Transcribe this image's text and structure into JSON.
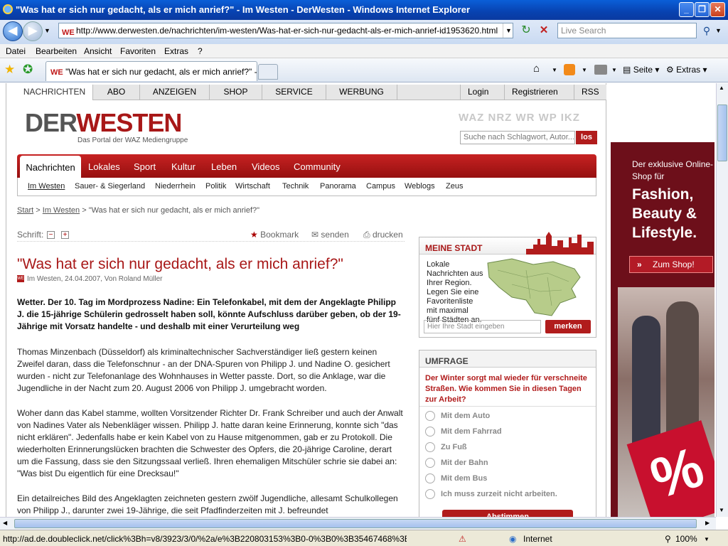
{
  "window": {
    "title": "\"Was hat er sich nur gedacht, als er mich anrief?\" - Im Westen - DerWesten - Windows Internet Explorer",
    "minimize": "_",
    "maximize": "❐",
    "close": "✕"
  },
  "address": {
    "favicon": "WE",
    "url": "http://www.derwesten.de/nachrichten/im-westen/Was-hat-er-sich-nur-gedacht-als-er-mich-anrief-id1953620.html",
    "search_placeholder": "Live Search"
  },
  "menu": [
    "Datei",
    "Bearbeiten",
    "Ansicht",
    "Favoriten",
    "Extras",
    "?"
  ],
  "tabs": {
    "active_label": "\"Was hat er sich nur gedacht, als er mich anrief?\" - Im...",
    "tools": {
      "page": "Seite",
      "extras": "Extras"
    }
  },
  "site": {
    "topnav": [
      "NACHRICHTEN",
      "ABO",
      "ANZEIGEN",
      "SHOP",
      "SERVICE",
      "WERBUNG"
    ],
    "topnav_right": [
      "Login",
      "Registrieren",
      "RSS"
    ],
    "logo_der": "DER",
    "logo_westen": "WESTEN",
    "slogan": "Das Portal der WAZ Mediengruppe",
    "brands": "WAZ NRZ WR WP IKZ",
    "search_placeholder": "Suche nach Schlagwort, Autor...",
    "search_button": "los",
    "mainnav": [
      "Nachrichten",
      "Lokales",
      "Sport",
      "Kultur",
      "Leben",
      "Videos",
      "Community"
    ],
    "subnav": [
      "Im Westen",
      "Sauer- & Siegerland",
      "Niederrhein",
      "Politik",
      "Wirtschaft",
      "Technik",
      "Panorama",
      "Campus",
      "Weblogs",
      "Zeus"
    ]
  },
  "breadcrumb": {
    "start": "Start",
    "section": "Im Westen",
    "current": "> \"Was hat er sich nur gedacht, als er mich anrief?\""
  },
  "article_tools": {
    "schrift": "Schrift:",
    "minus": "−",
    "plus": "+",
    "bookmark": "Bookmark",
    "send": "senden",
    "print": "drucken"
  },
  "article": {
    "headline": "\"Was hat er sich nur gedacht, als er mich anrief?\"",
    "meta": "Im Westen, 24.04.2007, Von Roland Müller",
    "lead": "Wetter. Der 10. Tag im Mordprozess Nadine: Ein Telefonkabel, mit dem der Angeklagte Philipp J. die 15-jährige Schülerin gedrosselt haben soll, könnte Aufschluss darüber geben, ob der 19-Jährige mit Vorsatz handelte - und deshalb mit einer Verurteilung weg",
    "p1": "Thomas Minzenbach (Düsseldorf) als kriminaltechnischer Sachverständiger ließ gestern keinen Zweifel daran, dass die Telefonschnur - an der DNA-Spuren von Philipp J. und Nadine O. gesichert wurden - nicht zur Telefonanlage des Wohnhauses in Wetter passte. Dort, so die Anklage, war die Jugendliche in der Nacht zum 20. August 2006 von Philipp J. umgebracht worden.",
    "p2": "Woher dann das Kabel stamme, wollten Vorsitzender Richter Dr. Frank Schreiber und auch der Anwalt von Nadines Vater als Nebenkläger wissen. Philipp J. hatte daran keine Erinnerung, konnte sich \"das nicht erklären\". Jedenfalls habe er kein Kabel von zu Hause mitgenommen, gab er zu Protokoll. Die wiederholten Erinnerungslücken brachten die Schwester des Opfers, die 20-jährige Caroline, derart um die Fassung, dass sie den Sitzungssaal verließ. Ihren ehemaligen Mitschüler schrie sie dabei an: \"Was bist Du eigentlich für eine Drecksau!\"",
    "p3": "Ein detailreiches Bild des Angeklagten zeichneten gestern zwölf Jugendliche, allesamt Schulkollegen von Philipp J., darunter zwei 19-Jährige, die seit Pfadfinderzeiten mit J. befreundet"
  },
  "meine_stadt": {
    "title": "MEINE STADT",
    "text": "Lokale Nachrichten aus Ihrer Region. Legen Sie eine Favoritenliste mit maximal fünf Städten an.",
    "input_placeholder": "Hier Ihre Stadt eingeben",
    "button": "merken"
  },
  "umfrage": {
    "title": "UMFRAGE",
    "question": "Der Winter sorgt mal wieder für verschneite Straßen. Wie kommen Sie in diesen Tagen zur Arbeit?",
    "options": [
      "Mit dem Auto",
      "Mit dem Fahrrad",
      "Zu Fuß",
      "Mit der Bahn",
      "Mit dem Bus",
      "Ich muss zurzeit nicht arbeiten."
    ],
    "button": "Abstimmen"
  },
  "ad": {
    "line1": "Der exklusive Online-Shop für",
    "line2": "Fashion, Beauty & Lifestyle.",
    "button": "Zum Shop!",
    "badge": "%"
  },
  "status": {
    "text": "http://ad.de.doubleclick.net/click%3Bh=v8/3923/3/0/%2a/e%3B220803153%3B0-0%3B0%3B35467468%3B933-12(",
    "zone": "Internet",
    "zoom": "100%"
  }
}
